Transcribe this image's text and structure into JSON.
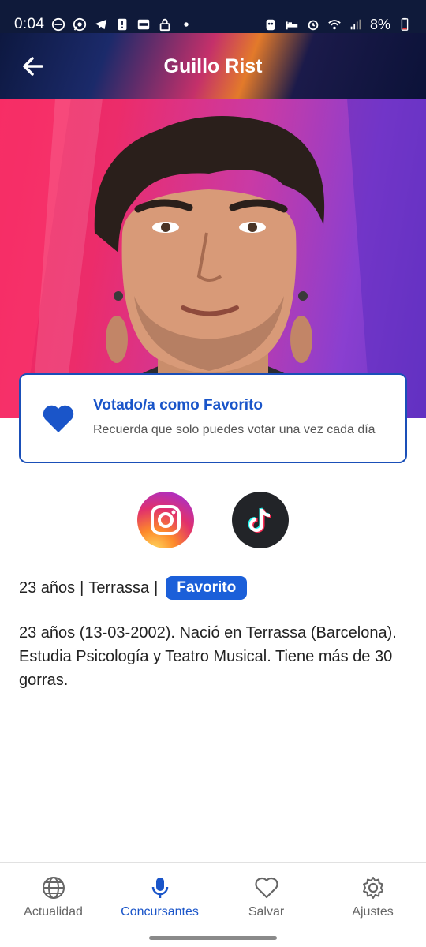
{
  "status_bar": {
    "time": "0:04",
    "battery_percent": "8%",
    "left_icons": [
      "dnd-icon",
      "whatsapp-icon",
      "telegram-icon",
      "alert-icon",
      "app-icon",
      "lock-icon",
      "dot-icon"
    ],
    "right_icons": [
      "android-icon",
      "bed-icon",
      "alarm-icon",
      "wifi-icon",
      "signal-icon",
      "battery-icon"
    ]
  },
  "header": {
    "title": "Guillo Rist",
    "back_icon": "arrow-left-icon"
  },
  "vote_card": {
    "title": "Votado/a como Favorito",
    "subtitle": "Recuerda que solo puedes votar una vez cada día",
    "icon": "heart-filled-icon",
    "accent": "#1a55c9"
  },
  "social": [
    {
      "name": "Instagram",
      "icon": "instagram-icon"
    },
    {
      "name": "TikTok",
      "icon": "tiktok-icon"
    }
  ],
  "profile": {
    "age": "23 años",
    "separator": "|",
    "city": "Terrassa",
    "badge": "Favorito",
    "bio": "23 años (13-03-2002). Nació en Terrassa (Barcelona). Estudia Psicología y Teatro Musical. Tiene más de 30 gorras."
  },
  "bottom_nav": {
    "items": [
      {
        "label": "Actualidad",
        "icon": "globe-icon",
        "active": false
      },
      {
        "label": "Concursantes",
        "icon": "microphone-icon",
        "active": true
      },
      {
        "label": "Salvar",
        "icon": "heart-outline-icon",
        "active": false
      },
      {
        "label": "Ajustes",
        "icon": "gear-icon",
        "active": false
      }
    ]
  },
  "colors": {
    "primary": "#1a55c9",
    "badge": "#1b5fd9",
    "status_bar_bg": "#0f1a3a"
  }
}
